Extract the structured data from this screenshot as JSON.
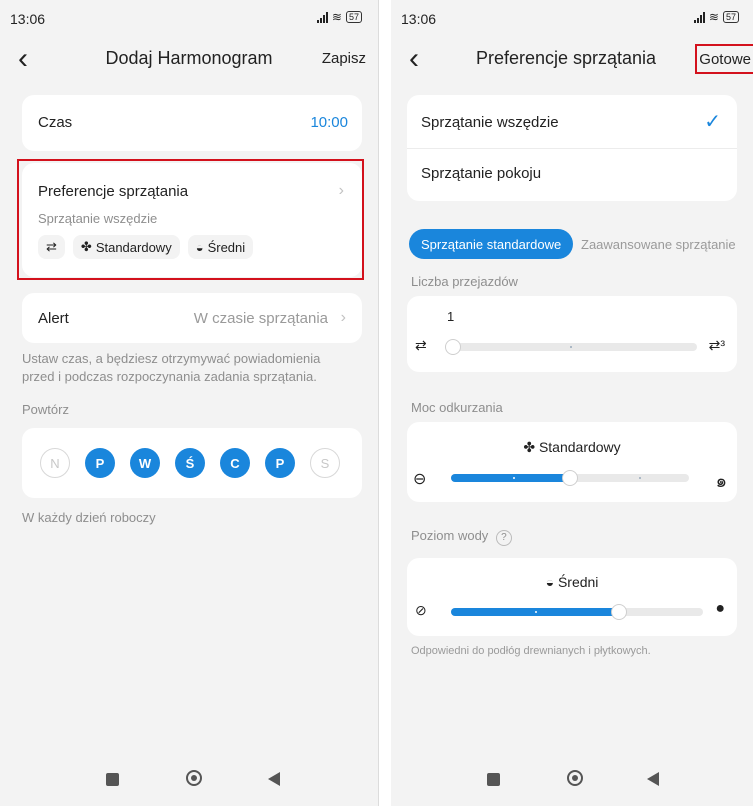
{
  "left": {
    "status": {
      "time": "13:06",
      "battery": "57"
    },
    "nav": {
      "back": "‹",
      "title": "Dodaj Harmonogram",
      "save": "Zapisz"
    },
    "time_row": {
      "label": "Czas",
      "value": "10:00"
    },
    "prefs": {
      "title": "Preferencje sprzątania",
      "subtitle": "Sprzątanie wszędzie",
      "chips": [
        {
          "icon": "passes-icon",
          "label": ""
        },
        {
          "icon": "fan-icon",
          "label": "Standardowy"
        },
        {
          "icon": "water-drop-icon",
          "label": "Średni"
        }
      ]
    },
    "alert": {
      "label": "Alert",
      "value": "W czasie sprzątania"
    },
    "note": "Ustaw czas, a będziesz otrzymywać powiadomienia przed i podczas rozpoczynania zadania sprzątania.",
    "repeat_label": "Powtórz",
    "days": [
      {
        "label": "N",
        "on": false
      },
      {
        "label": "P",
        "on": true
      },
      {
        "label": "W",
        "on": true
      },
      {
        "label": "Ś",
        "on": true
      },
      {
        "label": "C",
        "on": true
      },
      {
        "label": "P",
        "on": true
      },
      {
        "label": "S",
        "on": false
      }
    ],
    "repeat_summary": "W każdy dzień roboczy"
  },
  "right": {
    "status": {
      "time": "13:06",
      "battery": "57"
    },
    "nav": {
      "back": "‹",
      "title": "Preferencje sprzątania",
      "done": "Gotowe"
    },
    "options": [
      {
        "label": "Sprzątanie wszędzie",
        "selected": true
      },
      {
        "label": "Sprzątanie pokoju",
        "selected": false
      }
    ],
    "tabs": {
      "active": "Sprzątanie standardowe",
      "inactive": "Zaawansowane sprzątanie"
    },
    "passes": {
      "label": "Liczba przejazdów",
      "value": "1",
      "level": 0.0
    },
    "suction": {
      "label": "Moc odkurzania",
      "value": "Standardowy",
      "level": 0.5
    },
    "water": {
      "label": "Poziom wody",
      "help": "?",
      "value": "Średni",
      "level": 0.667
    },
    "water_note": "Odpowiedni do podłóg drewnianych i płytkowych."
  },
  "colors": {
    "accent": "#1a86dc",
    "highlight": "#d3111c"
  }
}
